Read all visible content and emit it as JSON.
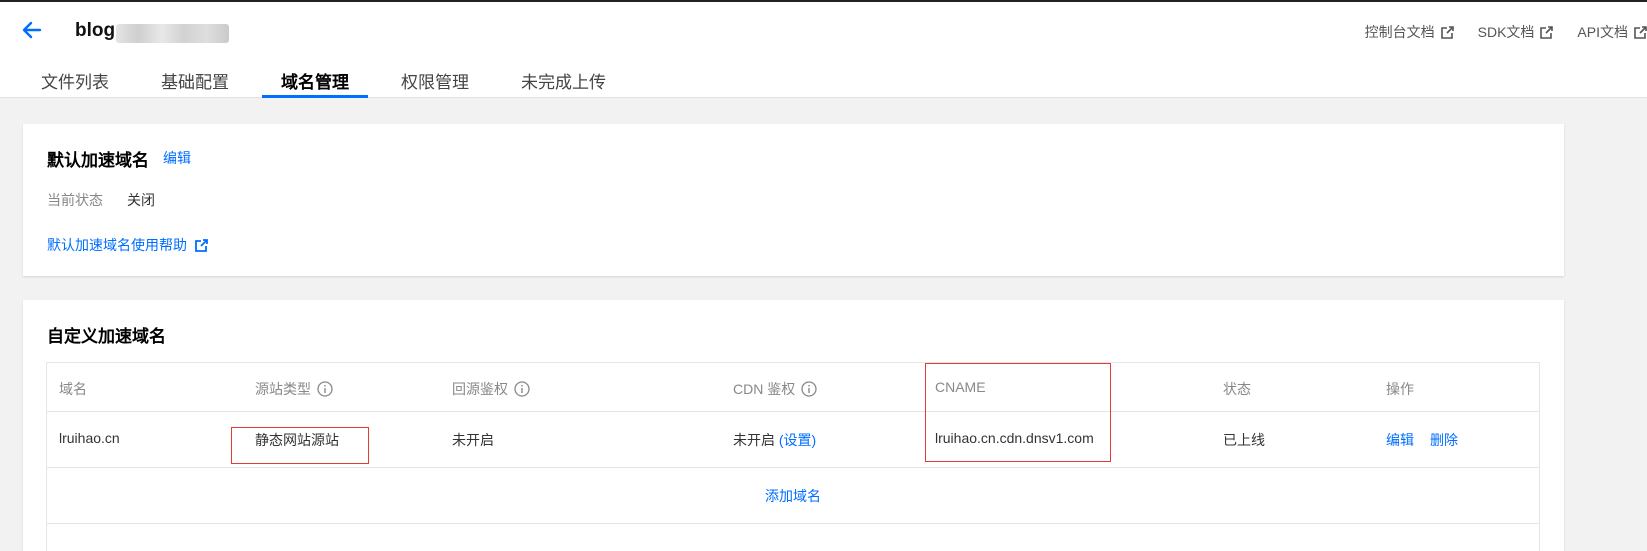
{
  "header": {
    "bucket_name": "blog",
    "doc_links": [
      "控制台文档",
      "SDK文档",
      "API文档"
    ]
  },
  "tabs": [
    "文件列表",
    "基础配置",
    "域名管理",
    "权限管理",
    "未完成上传"
  ],
  "active_tab": "域名管理",
  "default_domain": {
    "title": "默认加速域名",
    "edit": "编辑",
    "status_label": "当前状态",
    "status_value": "关闭",
    "help": "默认加速域名使用帮助"
  },
  "custom_domain": {
    "title": "自定义加速域名",
    "columns": [
      "域名",
      "源站类型",
      "回源鉴权",
      "CDN 鉴权",
      "CNAME",
      "状态",
      "操作"
    ],
    "rows": [
      {
        "domain": "lruihao.cn",
        "origin_type": "静态网站源站",
        "origin_auth": "未开启",
        "cdn_auth": "未开启",
        "cdn_auth_link": "(设置)",
        "cname": "lruihao.cn.cdn.dnsv1.com",
        "status": "已上线",
        "op_edit": "编辑",
        "op_delete": "删除"
      }
    ],
    "add_domain": "添加域名"
  },
  "colors": {
    "accent": "#006eff",
    "highlight": "#e53935"
  }
}
